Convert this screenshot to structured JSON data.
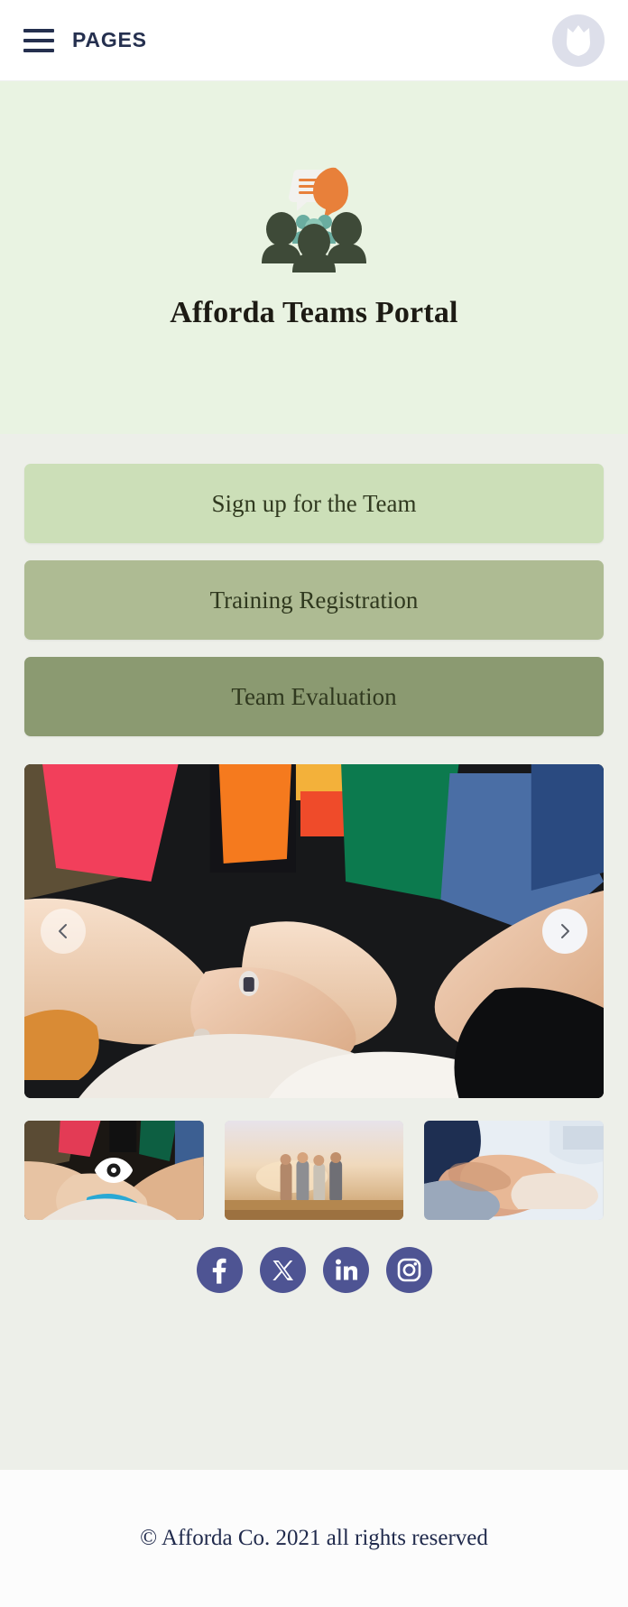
{
  "header": {
    "menu_icon": "hamburger-menu-icon",
    "menu_label": "PAGES",
    "avatar_icon": "user-avatar-icon",
    "text_color": "#25304f"
  },
  "hero": {
    "logo_icon": "team-speech-bubble-logo",
    "title": "Afforda Teams Portal",
    "background": "#e9f3e2"
  },
  "buttons": [
    {
      "label": "Sign up for the Team",
      "color": "#ccdfb8"
    },
    {
      "label": "Training Registration",
      "color": "#aebb93"
    },
    {
      "label": "Team Evaluation",
      "color": "#8b9a71"
    }
  ],
  "carousel": {
    "prev_icon": "chevron-left-icon",
    "next_icon": "chevron-right-icon",
    "active_index": 0,
    "slide_alt": "Group of people stacking hands together in colorful knit sweaters",
    "thumbnails": [
      {
        "alt": "Hands stacked together close up",
        "selected": true,
        "badge_icon": "eye-icon"
      },
      {
        "alt": "Four friends arm in arm at sunset",
        "selected": false,
        "badge_icon": ""
      },
      {
        "alt": "Business team gripping wrists in unity",
        "selected": false,
        "badge_icon": ""
      }
    ]
  },
  "social": [
    {
      "name": "facebook",
      "icon": "facebook-icon"
    },
    {
      "name": "x-twitter",
      "icon": "x-twitter-icon"
    },
    {
      "name": "linkedin",
      "icon": "linkedin-icon"
    },
    {
      "name": "instagram",
      "icon": "instagram-icon"
    }
  ],
  "social_color": "#4e5493",
  "footer": {
    "copyright": "© Afforda Co. 2021 all rights reserved"
  }
}
